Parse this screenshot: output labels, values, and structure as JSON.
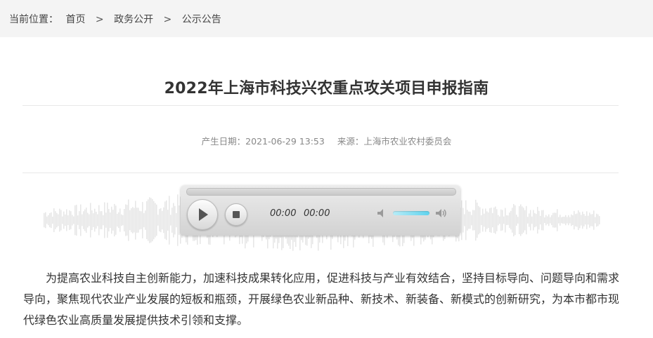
{
  "breadcrumb": {
    "prefix": "当前位置：",
    "items": [
      "首页",
      "政务公开",
      "公示公告"
    ],
    "separator": ">"
  },
  "article": {
    "title": "2022年上海市科技兴农重点攻关项目申报指南",
    "date_label": "产生日期：",
    "date_value": "2021-06-29 13:53",
    "source_label": "来源：",
    "source_value": "上海市农业农村委员会",
    "body": "为提高农业科技自主创新能力，加速科技成果转化应用，促进科技与产业有效结合，坚持目标导向、问题导向和需求导向，聚焦现代农业产业发展的短板和瓶颈，开展绿色农业新品种、新技术、新装备、新模式的创新研究，为本市都市现代绿色农业高质量发展提供技术引领和支撑。"
  },
  "audio_player": {
    "current_time": "00:00",
    "duration": "00:00",
    "volume_level": 0.85,
    "icons": {
      "play": "play-icon",
      "stop": "stop-icon",
      "mute": "volume-mute-icon",
      "max": "volume-max-icon"
    },
    "volume_color": "#5fd3ee"
  }
}
